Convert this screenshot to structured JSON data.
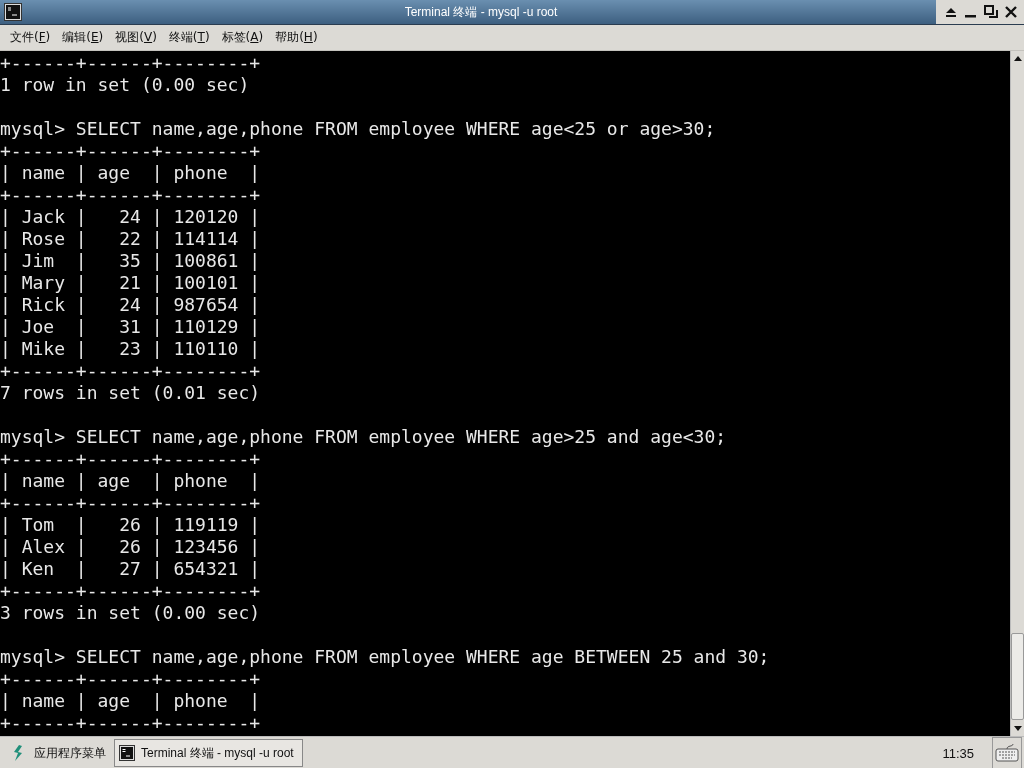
{
  "window": {
    "title": "Terminal 终端 - mysql -u root"
  },
  "menu": [
    {
      "label": "文件(F)"
    },
    {
      "label": "编辑(E)"
    },
    {
      "label": "视图(V)"
    },
    {
      "label": "终端(T)"
    },
    {
      "label": "标签(A)"
    },
    {
      "label": "帮助(H)"
    }
  ],
  "terminal_lines": [
    {
      "kind": "text",
      "text": "+------+------+--------+"
    },
    {
      "kind": "text",
      "text": "1 row in set (0.00 sec)"
    },
    {
      "kind": "blank"
    },
    {
      "kind": "text",
      "text": "mysql> SELECT name,age,phone FROM employee WHERE age<25 or age>30;"
    },
    {
      "kind": "text",
      "text": "+------+------+--------+"
    },
    {
      "kind": "text",
      "text": "| name | age  | phone  |"
    },
    {
      "kind": "text",
      "text": "+------+------+--------+"
    },
    {
      "kind": "text",
      "text": "| Jack |   24 | 120120 |"
    },
    {
      "kind": "text",
      "text": "| Rose |   22 | 114114 |"
    },
    {
      "kind": "text",
      "text": "| Jim  |   35 | 100861 |"
    },
    {
      "kind": "text",
      "text": "| Mary |   21 | 100101 |"
    },
    {
      "kind": "text",
      "text": "| Rick |   24 | 987654 |"
    },
    {
      "kind": "text",
      "text": "| Joe  |   31 | 110129 |"
    },
    {
      "kind": "text",
      "text": "| Mike |   23 | 110110 |"
    },
    {
      "kind": "text",
      "text": "+------+------+--------+"
    },
    {
      "kind": "text",
      "text": "7 rows in set (0.01 sec)"
    },
    {
      "kind": "blank"
    },
    {
      "kind": "text",
      "text": "mysql> SELECT name,age,phone FROM employee WHERE age>25 and age<30;"
    },
    {
      "kind": "text",
      "text": "+------+------+--------+"
    },
    {
      "kind": "text",
      "text": "| name | age  | phone  |"
    },
    {
      "kind": "text",
      "text": "+------+------+--------+"
    },
    {
      "kind": "text",
      "text": "| Tom  |   26 | 119119 |"
    },
    {
      "kind": "text",
      "text": "| Alex |   26 | 123456 |"
    },
    {
      "kind": "text",
      "text": "| Ken  |   27 | 654321 |"
    },
    {
      "kind": "text",
      "text": "+------+------+--------+"
    },
    {
      "kind": "text",
      "text": "3 rows in set (0.00 sec)"
    },
    {
      "kind": "blank"
    },
    {
      "kind": "text",
      "text": "mysql> SELECT name,age,phone FROM employee WHERE age BETWEEN 25 and 30;"
    },
    {
      "kind": "text",
      "text": "+------+------+--------+"
    },
    {
      "kind": "text",
      "text": "| name | age  | phone  |"
    },
    {
      "kind": "text",
      "text": "+------+------+--------+"
    }
  ],
  "taskbar": {
    "app_menu": "应用程序菜单",
    "task": "Terminal 终端 - mysql -u root",
    "clock": "11:35"
  }
}
